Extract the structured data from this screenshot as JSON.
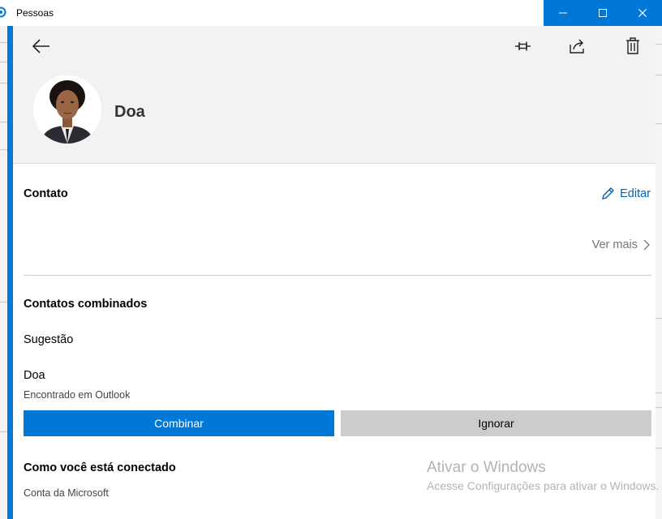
{
  "window": {
    "title": "Pessoas",
    "controls": {
      "minimize": "minimize",
      "maximize": "maximize",
      "close": "close"
    }
  },
  "header": {
    "back_icon": "arrow-left-icon",
    "actions": [
      "pin-icon",
      "share-icon",
      "trash-icon"
    ],
    "contact_name": "Doa"
  },
  "contact_section": {
    "title": "Contato",
    "edit_label": "Editar",
    "see_more_label": "Ver mais"
  },
  "linked_section": {
    "title": "Contatos combinados",
    "suggestion_label": "Sugestão",
    "suggestion_name": "Doa",
    "suggestion_source": "Encontrado em Outlook",
    "combine_label": "Combinar",
    "ignore_label": "Ignorar"
  },
  "connection_section": {
    "title": "Como você está conectado",
    "account": "Conta da Microsoft"
  },
  "activation": {
    "title": "Ativar o Windows",
    "message": "Acesse Configurações para ativar o Windows."
  },
  "colors": {
    "accent": "#0078d7",
    "link": "#0063b1",
    "header_bg": "#f2f2f2",
    "secondary_button": "#cccccc"
  }
}
